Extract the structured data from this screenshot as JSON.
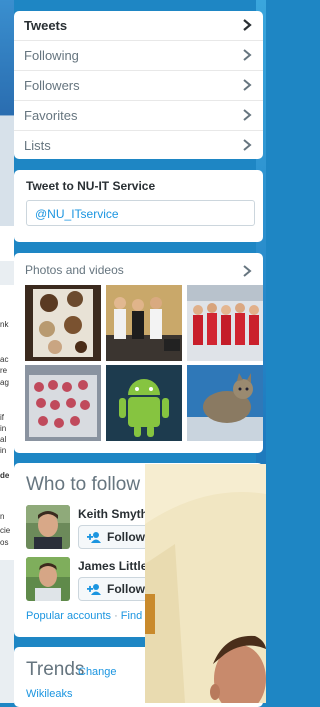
{
  "nav": {
    "items": [
      {
        "label": "Tweets",
        "active": true
      },
      {
        "label": "Following",
        "active": false
      },
      {
        "label": "Followers",
        "active": false
      },
      {
        "label": "Favorites",
        "active": false
      },
      {
        "label": "Lists",
        "active": false
      }
    ]
  },
  "tweet_to": {
    "title": "Tweet to NU-IT Service",
    "value": "@NU_ITservice"
  },
  "photos": {
    "title": "Photos and videos"
  },
  "who_to_follow": {
    "title": "Who to follow",
    "separator": "·",
    "users": [
      {
        "name": "Keith Smyth",
        "follow_label": "Follow"
      },
      {
        "name": "James Little",
        "follow_label": "Follow"
      }
    ],
    "footer_popular": "Popular accounts",
    "footer_dot": "·",
    "footer_find": "Find"
  },
  "trends": {
    "title": "Trends",
    "separator": "·",
    "change": "Change",
    "items": [
      "Wikileaks"
    ]
  },
  "background": {
    "left_fragments": [
      "nk",
      "ac",
      "re",
      "ag",
      "if",
      "in",
      "al",
      "in",
      "de",
      "n",
      "cie",
      "os"
    ]
  },
  "colors": {
    "link": "#1b95e0",
    "header_bg": "#1e86c4",
    "text_dark": "#292f33",
    "text_gray": "#66757f"
  }
}
